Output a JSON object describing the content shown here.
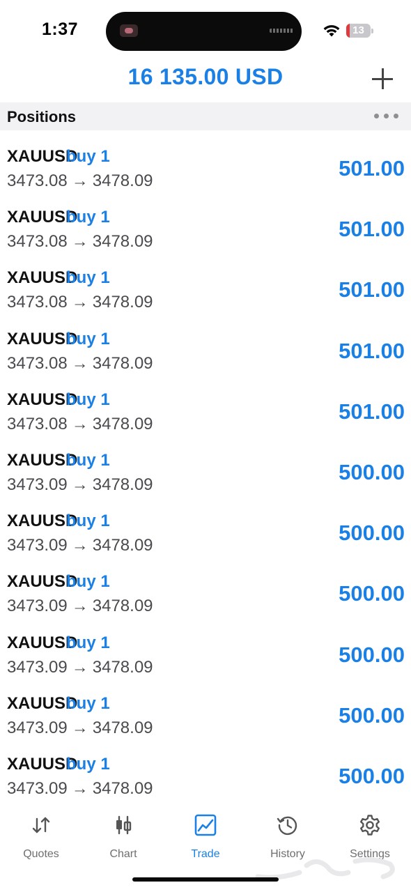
{
  "status_bar": {
    "time": "1:37",
    "battery_level": "13",
    "battery_percent": 0.13,
    "battery_color": "#e0393e"
  },
  "header": {
    "balance": "16 135.00 USD",
    "add_icon": "plus-icon"
  },
  "section": {
    "title": "Positions",
    "more_icon": "more-horizontal-icon"
  },
  "positions": [
    {
      "symbol": "XAUUSD",
      "side": "buy 1",
      "open_price": "3473.08",
      "arrow": "→",
      "current_price": "3478.09",
      "profit": "501.00"
    },
    {
      "symbol": "XAUUSD",
      "side": "buy 1",
      "open_price": "3473.08",
      "arrow": "→",
      "current_price": "3478.09",
      "profit": "501.00"
    },
    {
      "symbol": "XAUUSD",
      "side": "buy 1",
      "open_price": "3473.08",
      "arrow": "→",
      "current_price": "3478.09",
      "profit": "501.00"
    },
    {
      "symbol": "XAUUSD",
      "side": "buy 1",
      "open_price": "3473.08",
      "arrow": "→",
      "current_price": "3478.09",
      "profit": "501.00"
    },
    {
      "symbol": "XAUUSD",
      "side": "buy 1",
      "open_price": "3473.08",
      "arrow": "→",
      "current_price": "3478.09",
      "profit": "501.00"
    },
    {
      "symbol": "XAUUSD",
      "side": "buy 1",
      "open_price": "3473.09",
      "arrow": "→",
      "current_price": "3478.09",
      "profit": "500.00"
    },
    {
      "symbol": "XAUUSD",
      "side": "buy 1",
      "open_price": "3473.09",
      "arrow": "→",
      "current_price": "3478.09",
      "profit": "500.00"
    },
    {
      "symbol": "XAUUSD",
      "side": "buy 1",
      "open_price": "3473.09",
      "arrow": "→",
      "current_price": "3478.09",
      "profit": "500.00"
    },
    {
      "symbol": "XAUUSD",
      "side": "buy 1",
      "open_price": "3473.09",
      "arrow": "→",
      "current_price": "3478.09",
      "profit": "500.00"
    },
    {
      "symbol": "XAUUSD",
      "side": "buy 1",
      "open_price": "3473.09",
      "arrow": "→",
      "current_price": "3478.09",
      "profit": "500.00"
    },
    {
      "symbol": "XAUUSD",
      "side": "buy 1",
      "open_price": "3473.09",
      "arrow": "→",
      "current_price": "3478.09",
      "profit": "500.00"
    }
  ],
  "tab_bar": {
    "tabs": [
      {
        "label": "Quotes",
        "icon": "quotes-arrows-icon",
        "active": false
      },
      {
        "label": "Chart",
        "icon": "candlestick-chart-icon",
        "active": false
      },
      {
        "label": "Trade",
        "icon": "trade-line-chart-icon",
        "active": true
      },
      {
        "label": "History",
        "icon": "history-clock-icon",
        "active": false
      },
      {
        "label": "Settings",
        "icon": "gear-icon",
        "active": false
      }
    ]
  },
  "colors": {
    "accent": "#1a80e5",
    "text": "#111111",
    "secondary_text": "#4a4a4f",
    "inactive_tab": "#6e6e73",
    "section_background": "#f2f2f5"
  }
}
